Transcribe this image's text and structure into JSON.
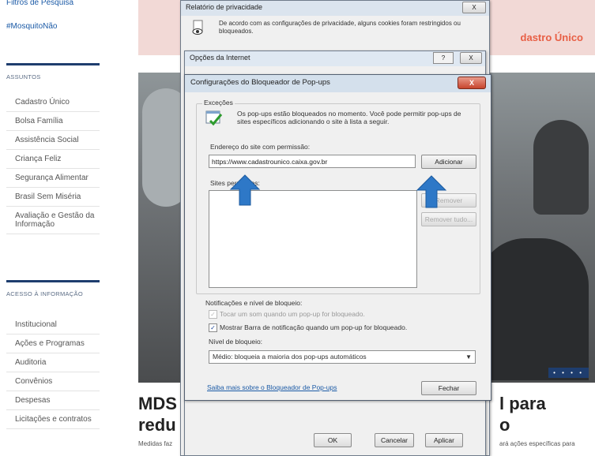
{
  "sidebar": {
    "link_top": "Filtros de Pesquisa",
    "hashtag": "#MosquitoNão",
    "assuntos_header": "ASSUNTOS",
    "assuntos": [
      "Cadastro Único",
      "Bolsa Família",
      "Assistência Social",
      "Criança Feliz",
      "Segurança Alimentar",
      "Brasil Sem Miséria",
      "Avaliação e Gestão da Informação"
    ],
    "acesso_header": "ACESSO À INFORMAÇÃO",
    "acesso": [
      "Institucional",
      "Ações e Programas",
      "Auditoria",
      "Convênios",
      "Despesas",
      "Licitações e contratos"
    ]
  },
  "main": {
    "banner_text": "dastro Único",
    "headline_left": "MDS\nredu",
    "headline_right": "l para\no",
    "lede_left": "Medidas faz",
    "lede_right": "ará ações específicas para",
    "carousel_dots": "• • • •"
  },
  "privacy_dialog": {
    "title": "Relatório de privacidade",
    "close": "X",
    "message": "De acordo com as configurações de privacidade, alguns cookies foram restringidos ou bloqueados."
  },
  "internet_options": {
    "title": "Opções da Internet",
    "help": "?",
    "close": "X",
    "ok": "OK",
    "cancel": "Cancelar",
    "apply": "Aplicar"
  },
  "popup_blocker": {
    "title": "Configurações do Bloqueador de Pop-ups",
    "close": "X",
    "exceptions_label": "Exceções",
    "exceptions_text": "Os pop-ups estão bloqueados no momento. Você pode permitir pop-ups de sites específicos adicionando o site à lista a seguir.",
    "address_label": "Endereço do site com permissão:",
    "address_value": "https://www.cadastrounico.caixa.gov.br",
    "add_button": "Adicionar",
    "allowed_label": "Sites permitidos:",
    "remove_button": "Remover",
    "remove_all_button": "Remover tudo...",
    "notif_label": "Notificações e nível de bloqueio:",
    "sound_option": "Tocar um som quando um pop-up for bloqueado.",
    "bar_option": "Mostrar Barra de notificação quando um pop-up for bloqueado.",
    "level_label": "Nível de bloqueio:",
    "level_value": "Médio: bloqueia a maioria dos pop-ups automáticos",
    "learn_more": "Saiba mais sobre o Bloqueador de Pop-ups",
    "close_button": "Fechar"
  },
  "colors": {
    "sidebar_rule": "#1e3d6e",
    "link": "#1b5aa6",
    "banner_accent": "#e85f45",
    "arrow": "#2e78c7"
  }
}
